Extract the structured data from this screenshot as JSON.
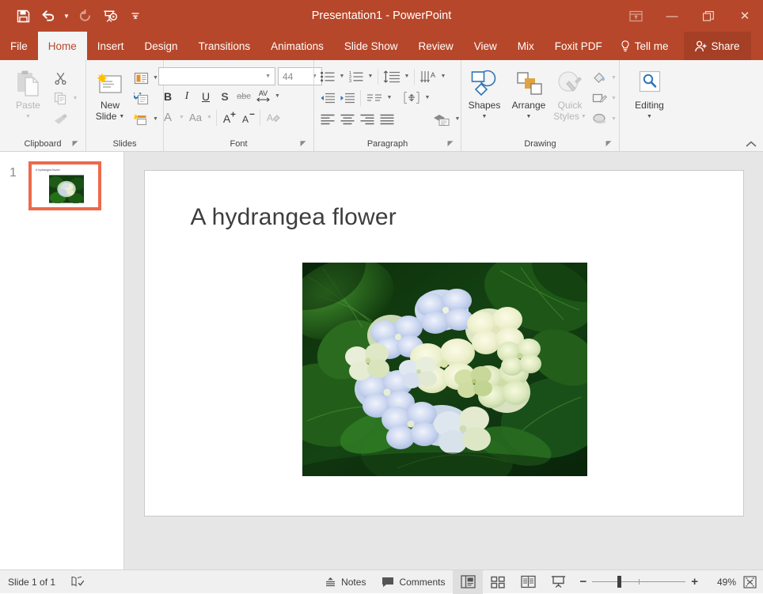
{
  "window": {
    "title": "Presentation1  -  PowerPoint",
    "quick_access": [
      {
        "name": "save",
        "icon": "save-icon"
      },
      {
        "name": "undo",
        "icon": "undo-icon"
      },
      {
        "name": "redo",
        "icon": "redo-icon"
      },
      {
        "name": "start-from-beginning",
        "icon": "start-slideshow-icon"
      },
      {
        "name": "customize-qat",
        "icon": "chevron-down-icon"
      }
    ],
    "controls": {
      "ribbon_display": "ribbon-display-options-icon",
      "minimize": "—",
      "restore": "❐",
      "close": "✕"
    },
    "accent_color": "#b7472a",
    "share_bg": "#a53f26"
  },
  "tabs": [
    {
      "label": "File",
      "active": false
    },
    {
      "label": "Home",
      "active": true
    },
    {
      "label": "Insert",
      "active": false
    },
    {
      "label": "Design",
      "active": false
    },
    {
      "label": "Transitions",
      "active": false
    },
    {
      "label": "Animations",
      "active": false
    },
    {
      "label": "Slide Show",
      "active": false
    },
    {
      "label": "Review",
      "active": false
    },
    {
      "label": "View",
      "active": false
    },
    {
      "label": "Mix",
      "active": false
    },
    {
      "label": "Foxit PDF",
      "active": false
    }
  ],
  "tell_me": "Tell me",
  "share": "Share",
  "ribbon": {
    "clipboard": {
      "label": "Clipboard",
      "paste": "Paste",
      "cut_icon": "scissors-icon",
      "copy_icon": "copy-icon",
      "format_painter_icon": "format-painter-icon"
    },
    "slides": {
      "label": "Slides",
      "new_slide": "New Slide",
      "layout_icon": "slide-layout-icon",
      "reset_icon": "reset-slide-icon",
      "section_icon": "section-icon"
    },
    "font": {
      "label": "Font",
      "font_name_value": "",
      "font_name_placeholder": "",
      "font_size_value": "44",
      "bold": "B",
      "italic": "I",
      "underline": "U",
      "shadow": "S",
      "strikethrough": "abc",
      "char_spacing": "AV",
      "font_color": "A",
      "change_case": "Aa",
      "increase_size": "A",
      "decrease_size": "A",
      "clear_formatting_icon": "clear-formatting-icon"
    },
    "paragraph": {
      "label": "Paragraph",
      "bullets_icon": "bullet-list-icon",
      "numbering_icon": "numbered-list-icon",
      "line_spacing_icon": "line-spacing-icon",
      "text_direction_icon": "text-direction-icon",
      "decrease_indent_icon": "decrease-indent-icon",
      "increase_indent_icon": "increase-indent-icon",
      "columns_icon": "columns-icon",
      "align_text_icon": "align-text-vertical-icon",
      "align_left_icon": "align-left-icon",
      "align_center_icon": "align-center-icon",
      "align_right_icon": "align-right-icon",
      "justify_icon": "justify-icon",
      "smartart_icon": "convert-to-smartart-icon"
    },
    "drawing": {
      "label": "Drawing",
      "shapes": "Shapes",
      "arrange": "Arrange",
      "quick_styles": "Quick Styles",
      "shape_fill_icon": "shape-fill-icon",
      "shape_outline_icon": "shape-outline-icon",
      "shape_effects_icon": "shape-effects-icon"
    },
    "editing": {
      "label": "",
      "editing": "Editing",
      "icon": "magnifier-icon"
    },
    "collapse_icon": "chevron-up-icon"
  },
  "thumbnails": [
    {
      "number": "1",
      "title": "A hydrangea flower",
      "selected": true
    }
  ],
  "slide": {
    "title": "A hydrangea flower",
    "image_name": "hydrangea-photo",
    "image_alt": "Pale blue and cream hydrangea blossom among dark green leaves"
  },
  "status": {
    "slide_count": "Slide 1 of 1",
    "accessibility_icon": "spell-check-icon",
    "notes": "Notes",
    "comments": "Comments",
    "views": [
      {
        "name": "normal-view",
        "icon": "normal-view-icon",
        "active": true
      },
      {
        "name": "slide-sorter-view",
        "icon": "slide-sorter-icon",
        "active": false
      },
      {
        "name": "reading-view",
        "icon": "reading-view-icon",
        "active": false
      },
      {
        "name": "slide-show-view",
        "icon": "slide-show-icon",
        "active": false
      }
    ],
    "zoom_out": "−",
    "zoom_in": "+",
    "zoom_level": "49%",
    "fit_to_window_icon": "fit-to-window-icon"
  }
}
